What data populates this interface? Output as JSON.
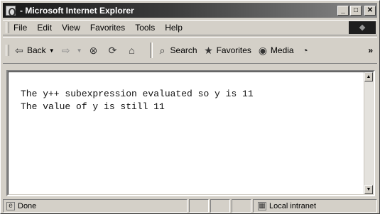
{
  "window": {
    "title": "- Microsoft Internet Explorer"
  },
  "menu": [
    {
      "label": "File"
    },
    {
      "label": "Edit"
    },
    {
      "label": "View"
    },
    {
      "label": "Favorites"
    },
    {
      "label": "Tools"
    },
    {
      "label": "Help"
    }
  ],
  "toolbar": {
    "back": "Back",
    "search": "Search",
    "favorites": "Favorites",
    "media": "Media"
  },
  "content": {
    "lines": [
      "The y++ subexpression evaluated so y is 11",
      "The value of y is still 11"
    ]
  },
  "status": {
    "text": "Done",
    "zone": "Local intranet"
  }
}
